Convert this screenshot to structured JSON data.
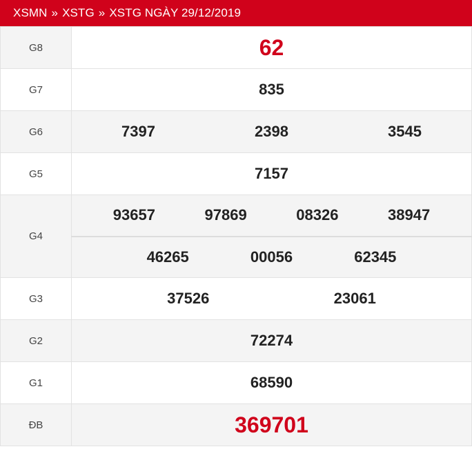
{
  "breadcrumb": {
    "items": [
      "XSMN",
      "XSTG",
      "XSTG NGÀY 29/12/2019"
    ],
    "separator": "»"
  },
  "colors": {
    "header_bg": "#d0021b",
    "highlight_red": "#d0021b",
    "row_alt_bg": "#f4f4f4"
  },
  "prizes": {
    "g8": {
      "label": "G8",
      "numbers": [
        "62"
      ]
    },
    "g7": {
      "label": "G7",
      "numbers": [
        "835"
      ]
    },
    "g6": {
      "label": "G6",
      "numbers": [
        "7397",
        "2398",
        "3545"
      ]
    },
    "g5": {
      "label": "G5",
      "numbers": [
        "7157"
      ]
    },
    "g4": {
      "label": "G4",
      "numbers": [
        "93657",
        "97869",
        "08326",
        "38947",
        "46265",
        "00056",
        "62345"
      ]
    },
    "g3": {
      "label": "G3",
      "numbers": [
        "37526",
        "23061"
      ]
    },
    "g2": {
      "label": "G2",
      "numbers": [
        "72274"
      ]
    },
    "g1": {
      "label": "G1",
      "numbers": [
        "68590"
      ]
    },
    "db": {
      "label": "ĐB",
      "numbers": [
        "369701"
      ]
    }
  }
}
